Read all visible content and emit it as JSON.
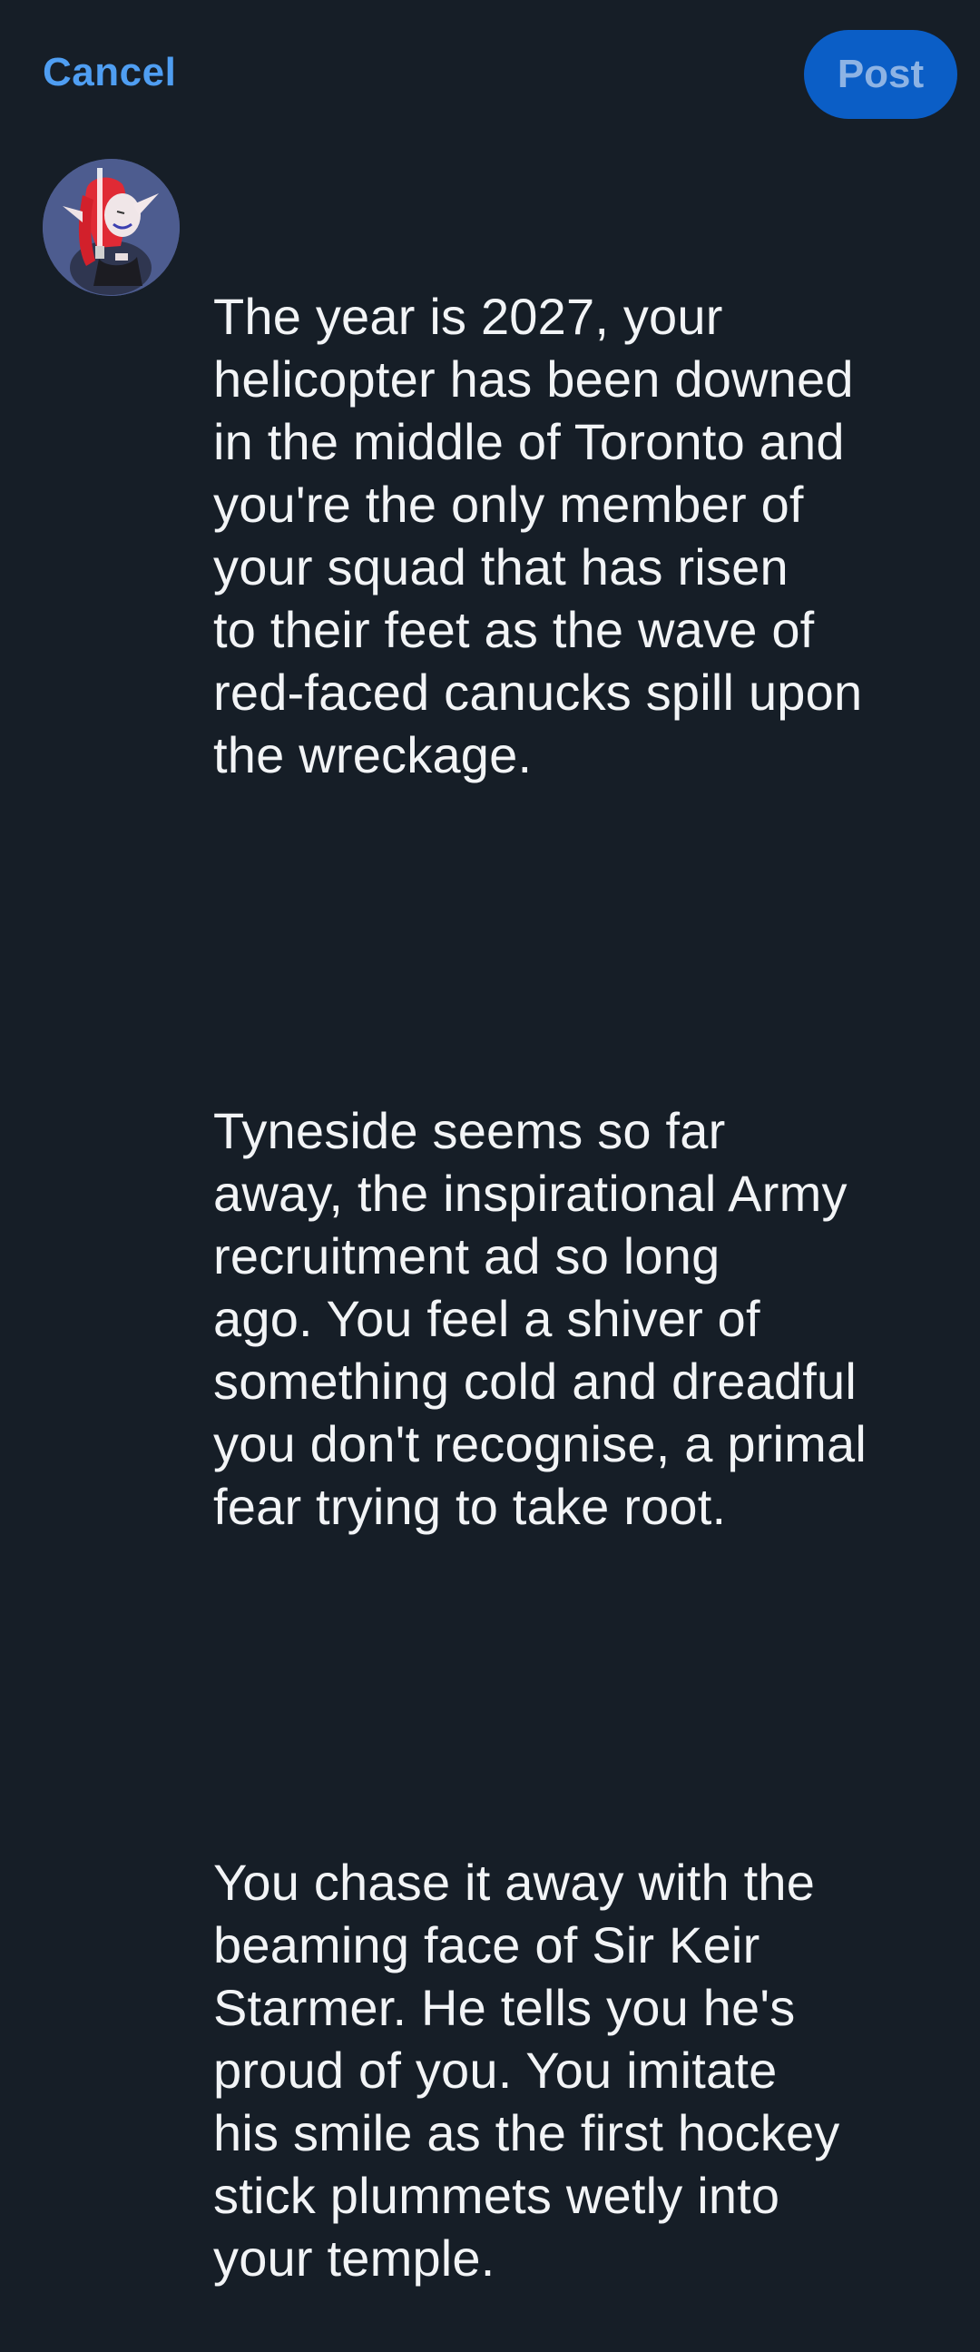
{
  "header": {
    "cancel_label": "Cancel",
    "post_label": "Post"
  },
  "colors": {
    "background": "#161e27",
    "accent": "#4f9ef2",
    "post_button_bg": "#0b5ec6",
    "post_button_text": "#8db3e4",
    "text": "#f2f4f6"
  },
  "composer": {
    "avatar_icon": "user-avatar",
    "paragraphs": [
      "The year is 2027, your\nhelicopter has been downed\nin the middle of Toronto and\nyou're the only member of\nyour squad that has risen\nto their feet as the wave of\nred-faced canucks spill upon\nthe wreckage.",
      "Tyneside seems so far\naway, the inspirational Army\nrecruitment ad so long\nago. You feel a shiver of\nsomething cold and dreadful\nyou don't recognise, a primal\nfear trying to take root.",
      "You chase it away with the\nbeaming face of Sir Keir\nStarmer. He tells you he's\nproud of you. You imitate\nhis smile as the first hockey\nstick plummets wetly into\nyour temple."
    ]
  }
}
